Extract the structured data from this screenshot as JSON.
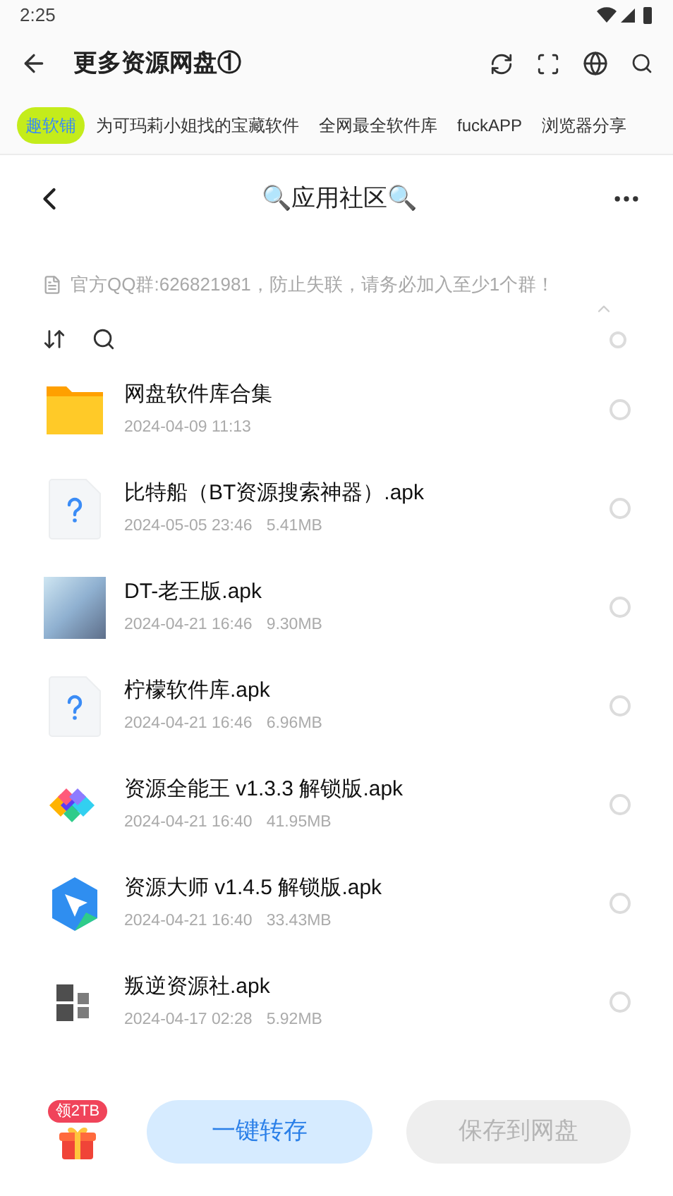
{
  "status_bar": {
    "time": "2:25"
  },
  "app_bar": {
    "title": "更多资源网盘①"
  },
  "tabs": [
    {
      "label": "趣软铺",
      "selected": true
    },
    {
      "label": "为可玛莉小姐找的宝藏软件",
      "selected": false
    },
    {
      "label": "全网最全软件库",
      "selected": false
    },
    {
      "label": "fuckAPP",
      "selected": false
    },
    {
      "label": "浏览器分享",
      "selected": false
    }
  ],
  "share_header": {
    "title": "🔍应用社区🔍"
  },
  "notice": "官方QQ群:626821981，防止失联，请务必加入至少1个群！",
  "select_all": {
    "selected": false
  },
  "files": [
    {
      "kind": "folder",
      "name": "网盘软件库合集",
      "date": "2024-04-09 11:13",
      "selected": false
    },
    {
      "kind": "unknown",
      "name": "比特船（BT资源搜索神器）.apk",
      "date": "2024-05-05 23:46",
      "size": "5.41MB",
      "selected": false
    },
    {
      "kind": "photo",
      "name": "DT-老王版.apk",
      "date": "2024-04-21 16:46",
      "size": "9.30MB",
      "selected": false
    },
    {
      "kind": "unknown",
      "name": "柠檬软件库.apk",
      "date": "2024-04-21 16:46",
      "size": "6.96MB",
      "selected": false
    },
    {
      "kind": "diamonds",
      "name": "资源全能王 v1.3.3 解锁版.apk",
      "date": "2024-04-21 16:40",
      "size": "41.95MB",
      "selected": false
    },
    {
      "kind": "hexagon",
      "name": "资源大师 v1.4.5 解锁版.apk",
      "date": "2024-04-21 16:40",
      "size": "33.43MB",
      "selected": false
    },
    {
      "kind": "calligraphy",
      "name": "叛逆资源社.apk",
      "date": "2024-04-17 02:28",
      "size": "5.92MB",
      "selected": false
    }
  ],
  "bottom_bar": {
    "gift_badge": "领2TB",
    "primary_button": "一键转存",
    "secondary_button": "保存到网盘"
  }
}
